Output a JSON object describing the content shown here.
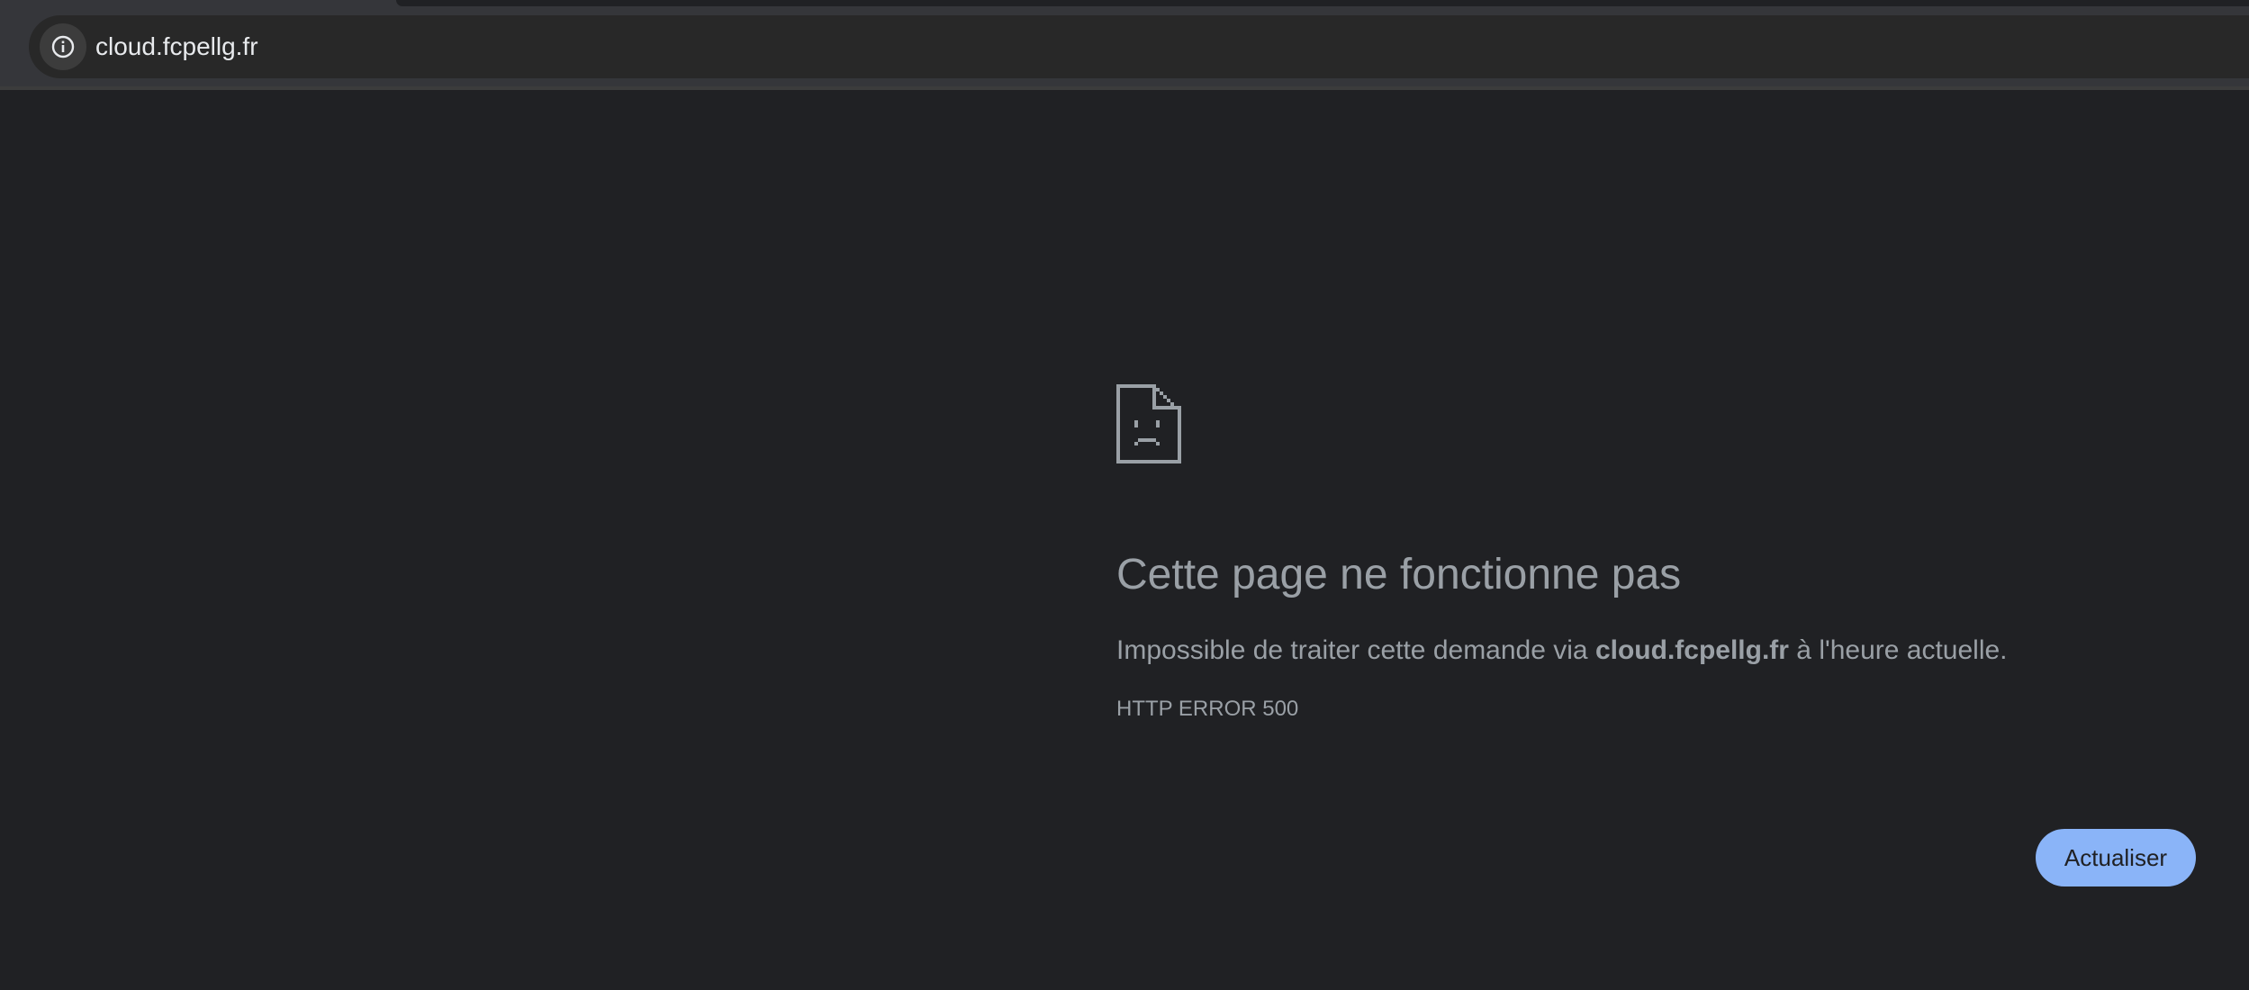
{
  "address_bar": {
    "url": "cloud.fcpellg.fr",
    "info_icon": "info-icon"
  },
  "error_page": {
    "icon": "sad-document-icon",
    "headline": "Cette page ne fonctionne pas",
    "summary_prefix": "Impossible de traiter cette demande via ",
    "summary_host": "cloud.fcpellg.fr",
    "summary_suffix": " à l'heure actuelle.",
    "error_code": "HTTP ERROR 500",
    "reload_label": "Actualiser"
  },
  "colors": {
    "page_background": "#202124",
    "text_secondary": "#9aa0a6",
    "button_blue": "#8ab4f8"
  }
}
